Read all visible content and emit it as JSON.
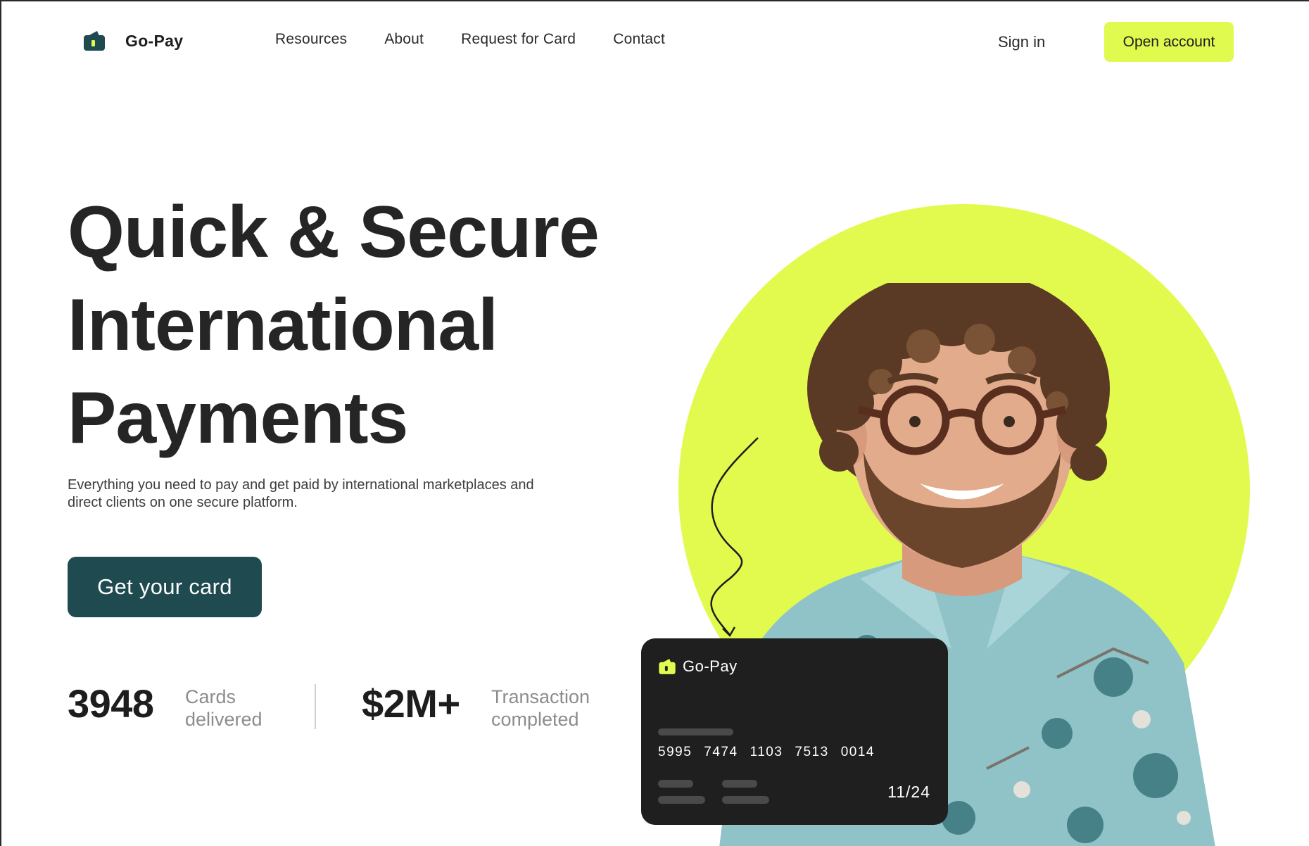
{
  "brand": {
    "name": "Go-Pay",
    "accent_color": "#e0fa4f",
    "primary_color": "#1e4a50",
    "logo_icon": "wallet-icon"
  },
  "nav": {
    "links": [
      {
        "label": "Resources"
      },
      {
        "label": "About"
      },
      {
        "label": "Request for Card"
      },
      {
        "label": "Contact"
      }
    ],
    "sign_in": "Sign in",
    "open_account": "Open account"
  },
  "hero": {
    "title_lines": [
      "Quick & Secure",
      "International",
      "Payments"
    ],
    "subtitle_lines": [
      "Everything you need to pay and get paid by international marketplaces and",
      "direct clients on one secure platform."
    ],
    "cta": "Get your card"
  },
  "stats": [
    {
      "value": "3948",
      "label_lines": [
        "Cards",
        "delivered"
      ]
    },
    {
      "value": "$2M+",
      "label_lines": [
        "Transaction",
        "completed"
      ]
    }
  ],
  "card": {
    "brand": "Go-Pay",
    "number_groups": [
      "5995",
      "7474",
      "1103",
      "7513",
      "0014"
    ],
    "expiry": "11/24"
  }
}
